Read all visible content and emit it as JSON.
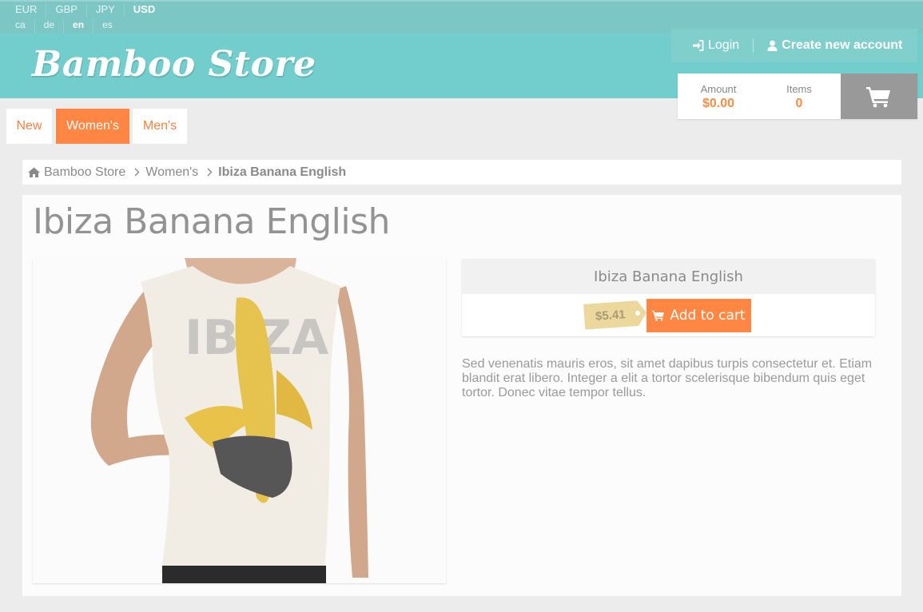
{
  "currencies": [
    {
      "code": "EUR",
      "active": false
    },
    {
      "code": "GBP",
      "active": false
    },
    {
      "code": "JPY",
      "active": false
    },
    {
      "code": "USD",
      "active": true
    }
  ],
  "languages": [
    {
      "code": "ca",
      "active": false
    },
    {
      "code": "de",
      "active": false
    },
    {
      "code": "en",
      "active": true
    },
    {
      "code": "es",
      "active": false
    }
  ],
  "header": {
    "logo_text": "Bamboo Store",
    "login_label": "Login",
    "create_account_label": "Create new account"
  },
  "cart": {
    "amount_label": "Amount",
    "amount_value": "$0.00",
    "items_label": "Items",
    "items_value": "0",
    "icon": "shopping-cart-icon"
  },
  "nav": {
    "items": [
      {
        "label": "New",
        "active": false
      },
      {
        "label": "Women's",
        "active": true
      },
      {
        "label": "Men's",
        "active": false
      }
    ]
  },
  "breadcrumb": {
    "home_label": "Bamboo Store",
    "category_label": "Women's",
    "current_label": "Ibiza Banana English"
  },
  "product": {
    "title": "Ibiza Banana English",
    "box_title": "Ibiza Banana English",
    "price": "$5.41",
    "add_to_cart_label": "Add to cart",
    "description": "Sed venenatis mauris eros, sit amet dapibus turpis consectetur et. Etiam blandit erat libero. Integer a elit a tortor scelerisque bibendum quis eget tortor. Donec vitae tempor tellus.",
    "image_text": "IBIZA"
  },
  "colors": {
    "teal_header": "#72cdcd",
    "accent_orange": "#ff8743",
    "price_tag": "#ecd79c",
    "cart_button": "#999999"
  }
}
